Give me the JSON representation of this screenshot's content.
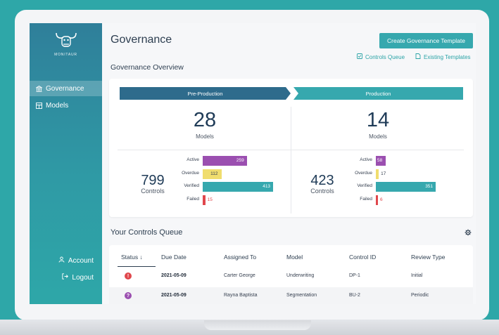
{
  "brand": {
    "name": "MONITAUR"
  },
  "sidebar": {
    "items": [
      {
        "label": "Governance",
        "icon": "bank-icon"
      },
      {
        "label": "Models",
        "icon": "table-icon"
      }
    ],
    "account_label": "Account",
    "logout_label": "Logout"
  },
  "header": {
    "title": "Governance",
    "create_button": "Create Governance Template",
    "links": {
      "controls_queue": "Controls Queue",
      "existing_templates": "Existing Templates"
    }
  },
  "overview": {
    "title": "Governance Overview",
    "stages": [
      {
        "label": "Pre-Production",
        "models_count": "28",
        "models_label": "Models",
        "controls_count": "799",
        "controls_label": "Controls",
        "bars": [
          {
            "label": "Active",
            "value": 259,
            "display": "259"
          },
          {
            "label": "Overdue",
            "value": 112,
            "display": "112"
          },
          {
            "label": "Verified",
            "value": 413,
            "display": "413"
          },
          {
            "label": "Failed",
            "value": 15,
            "display": "15"
          }
        ]
      },
      {
        "label": "Production",
        "models_count": "14",
        "models_label": "Models",
        "controls_count": "423",
        "controls_label": "Controls",
        "bars": [
          {
            "label": "Active",
            "value": 58,
            "display": "58"
          },
          {
            "label": "Overdue",
            "value": 17,
            "display": "17"
          },
          {
            "label": "Verified",
            "value": 351,
            "display": "351"
          },
          {
            "label": "Failed",
            "value": 6,
            "display": "6"
          }
        ]
      }
    ],
    "bar_colors": {
      "Active": "#9b4fb0",
      "Overdue": "#f0dd6e",
      "Verified": "#36a8ae",
      "Failed": "#e0474c"
    }
  },
  "queue": {
    "title": "Your Controls Queue",
    "columns": [
      "Status ↓",
      "Due Date",
      "Assigned To",
      "Model",
      "Control ID",
      "Review Type"
    ],
    "rows": [
      {
        "status": "!",
        "status_color": "#e0474c",
        "due": "2021-05-09",
        "assigned": "Carter George",
        "model": "Underwriting",
        "control": "DP-1",
        "review": "Initial"
      },
      {
        "status": "?",
        "status_color": "#9b4fb0",
        "due": "2021-05-09",
        "assigned": "Rayna Baptista",
        "model": "Segmentation",
        "control": "BU-2",
        "review": "Periodic"
      }
    ]
  }
}
